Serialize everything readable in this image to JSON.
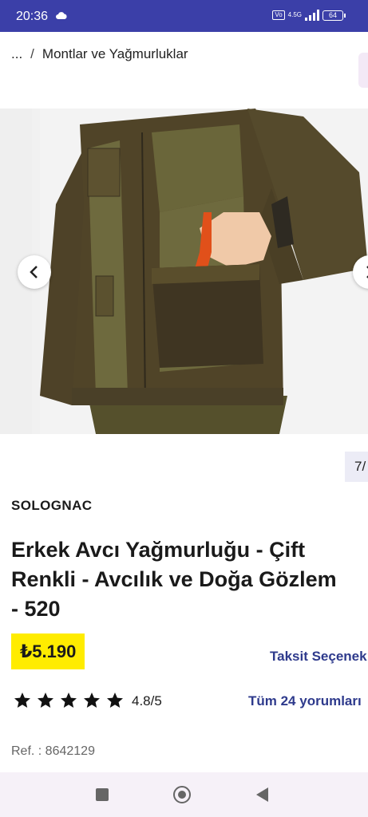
{
  "status_bar": {
    "time": "20:36",
    "network": "4.5G",
    "battery": "64",
    "icons": [
      "cloud-icon",
      "volte-icon",
      "signal-icon",
      "battery-icon"
    ]
  },
  "breadcrumb": {
    "ellipsis": "...",
    "separator": "/",
    "current": "Montlar ve Yağmurluklar"
  },
  "gallery": {
    "counter": "7/",
    "prev_icon": "chevron-left-icon",
    "next_icon": "chevron-right-icon"
  },
  "product": {
    "brand": "SOLOGNAC",
    "title_lines": [
      "Erkek Avcı Yağmurluğu - Çift",
      "Renkli - Avcılık ve Doğa Gözlem",
      "- 520"
    ],
    "price": "₺5.190",
    "installment_link": "Taksit Seçenek",
    "rating": "4.8/5",
    "rating_stars": 5,
    "reviews_link": "Tüm 24 yorumları",
    "ref": "Ref. : 8642129"
  },
  "colors": {
    "status_bar": "#3b3fa8",
    "price_bg": "#ffec00",
    "link": "#2e3a8c",
    "jacket_dark": "#4e4228",
    "jacket_light": "#6e6a3e"
  }
}
